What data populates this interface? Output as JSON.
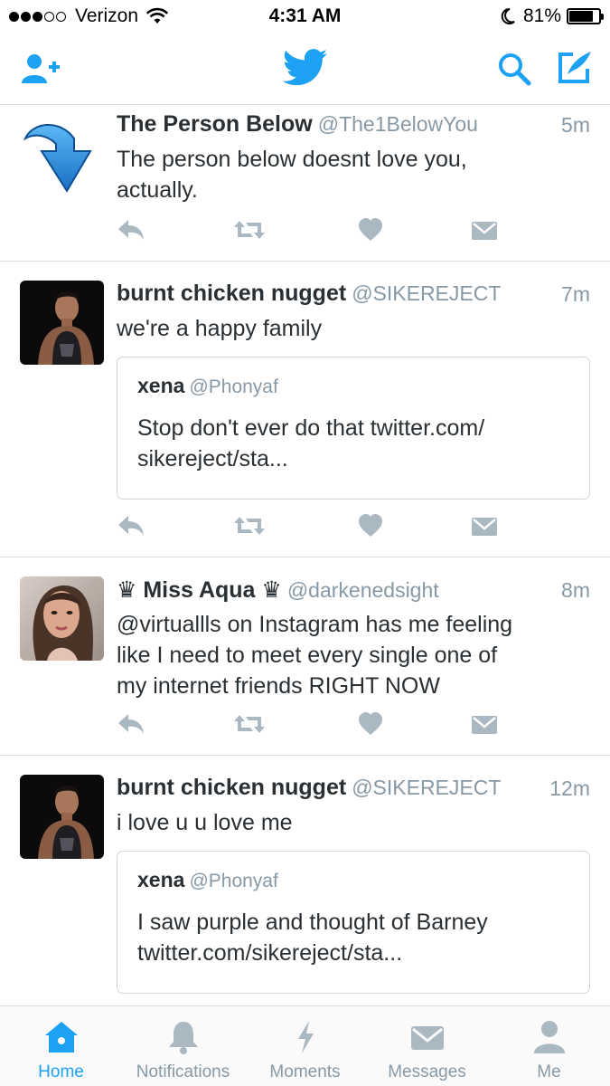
{
  "status_bar": {
    "carrier": "Verizon",
    "time": "4:31 AM",
    "battery": "81%",
    "battery_level": 0.81
  },
  "colors": {
    "accent": "#1da1f2",
    "icon_gray": "#aab8c2",
    "text": "#292f33",
    "muted": "#8899a6"
  },
  "nav": {
    "left_icon": "add-user-icon",
    "center_icon": "twitter-bird-icon",
    "right_icons": [
      "search-icon",
      "compose-tweet-icon"
    ]
  },
  "tweets": [
    {
      "name": "The Person Below",
      "handle": "@The1BelowYou",
      "time": "5m",
      "text_lines": [
        "The person below doesnt love you,",
        "actually."
      ]
    },
    {
      "name": "burnt chicken nugget",
      "handle": "@SIKEREJECT",
      "time": "7m",
      "text_lines": [
        "we're a happy family"
      ],
      "quote": {
        "name": "xena",
        "handle": "@Phonyaf",
        "text_lines": [
          "Stop don't ever do that  twitter.com/",
          "sikereject/sta..."
        ]
      }
    },
    {
      "name": "♛ Miss Aqua ♛",
      "handle": "@darkenedsight",
      "time": "8m",
      "text_lines": [
        "@virtuallls on Instagram has me feeling",
        "like I need to meet every single one of",
        "my internet friends RIGHT NOW"
      ]
    },
    {
      "name": "burnt chicken nugget",
      "handle": "@SIKEREJECT",
      "time": "12m",
      "text_lines": [
        "i love u u love me"
      ],
      "quote": {
        "name": "xena",
        "handle": "@Phonyaf",
        "text_lines": [
          "I saw purple and thought of Barney",
          "twitter.com/sikereject/sta..."
        ]
      }
    }
  ],
  "tweet_actions": [
    "reply-icon",
    "retweet-icon",
    "like-icon",
    "direct-message-icon"
  ],
  "tabs": [
    {
      "label": "Home",
      "icon": "home-icon",
      "active": true
    },
    {
      "label": "Notifications",
      "icon": "bell-icon",
      "active": false
    },
    {
      "label": "Moments",
      "icon": "lightning-icon",
      "active": false
    },
    {
      "label": "Messages",
      "icon": "envelope-icon",
      "active": false
    },
    {
      "label": "Me",
      "icon": "person-icon",
      "active": false
    }
  ]
}
